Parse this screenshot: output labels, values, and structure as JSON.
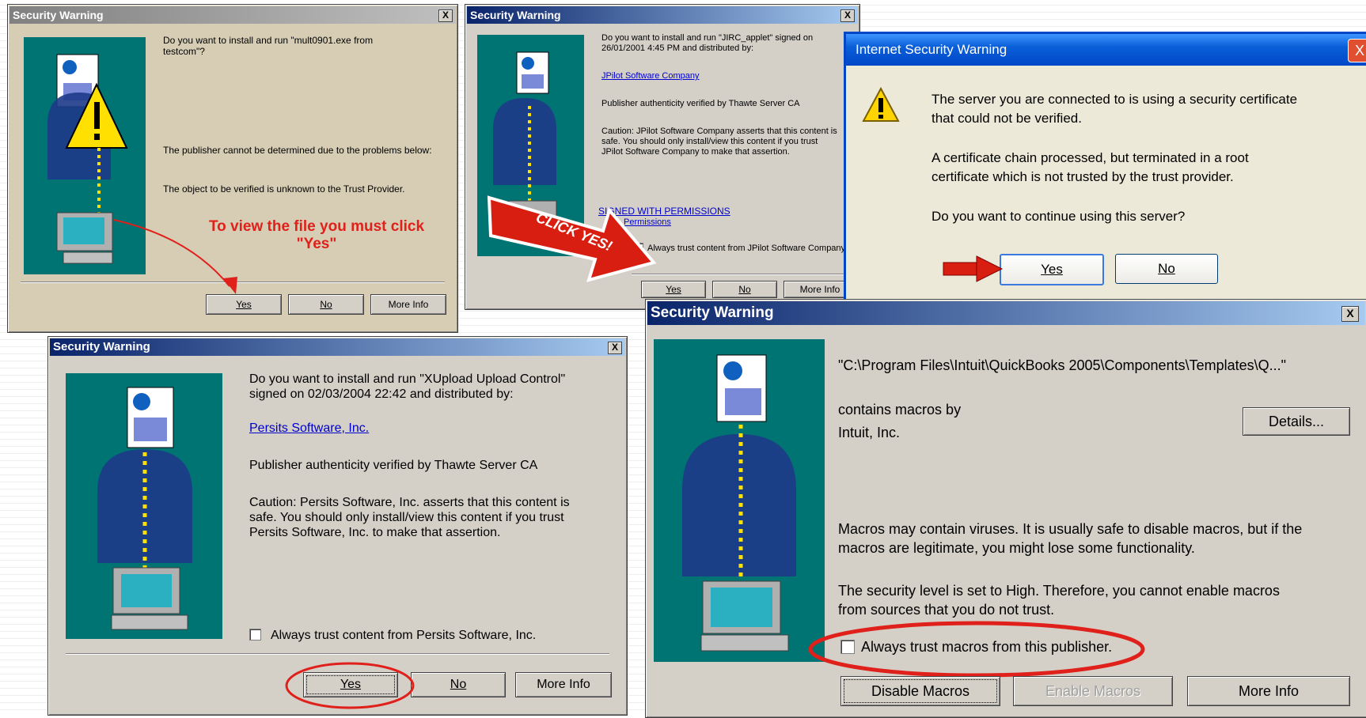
{
  "d1": {
    "title": "Security Warning",
    "question": "Do you want to install and run \"mult0901.exe from testcom\"?",
    "publisher_msg": "The publisher cannot be determined due to the problems below:",
    "object_msg": "The object to be verified is unknown to the Trust Provider.",
    "annotation_line1": "To view the file you must click",
    "annotation_line2": "\"Yes\"",
    "yes": "Yes",
    "no": "No",
    "more": "More Info",
    "close": "X"
  },
  "d2": {
    "title": "Security Warning",
    "question": "Do you want to install and run \"JIRC_applet\" signed on 26/01/2001 4:45 PM and distributed by:",
    "company": "JPilot Software Company",
    "verified": "Publisher authenticity verified by Thawte Server CA",
    "caution": "Caution: JPilot Software Company asserts that this content is safe. You should only install/view this content if you trust JPilot Software Company to make that assertion.",
    "signed_link": "SIGNED WITH PERMISSIONS",
    "permissions_link": "Permissions",
    "trust": "Always trust content from JPilot Software Company",
    "click_yes": "CLICK YES!",
    "yes": "Yes",
    "no": "No",
    "more": "More Info",
    "close": "X"
  },
  "d3": {
    "title": "Internet Security Warning",
    "line1": "The server you are connected to is using a security certificate",
    "line2": "that could not be verified.",
    "line3": "A certificate chain processed, but terminated in a root",
    "line4": "certificate which is not trusted by the trust provider.",
    "line5": "Do you want to continue using this server?",
    "yes": "Yes",
    "no": "No",
    "close": "X"
  },
  "d4": {
    "title": "Security Warning",
    "question1": "Do you want to install and run \"XUpload Upload Control\"",
    "question2": "signed on 02/03/2004 22:42 and distributed by:",
    "company": "Persits Software, Inc.",
    "verified": "Publisher authenticity verified by Thawte Server CA",
    "caution1": "Caution: Persits Software, Inc. asserts that this content is",
    "caution2": "safe.  You should only install/view this content if you trust",
    "caution3": "Persits Software, Inc. to make that assertion.",
    "trust": "Always trust content from Persits Software, Inc.",
    "yes": "Yes",
    "no": "No",
    "more": "More Info",
    "close": "X"
  },
  "d5": {
    "title": "Security Warning",
    "path": "\"C:\\Program Files\\Intuit\\QuickBooks 2005\\Components\\Templates\\Q...\"",
    "macros_by": "contains macros by",
    "publisher": "Intuit, Inc.",
    "details": "Details...",
    "virus1": "Macros may contain viruses. It is usually safe to disable macros, but if the",
    "virus2": "macros are legitimate, you might lose some functionality.",
    "level1": "The security level is set to High.  Therefore, you cannot enable macros",
    "level2": "from sources that you do not trust.",
    "trust": "Always trust macros from this publisher.",
    "disable": "Disable Macros",
    "enable": "Enable Macros",
    "more": "More Info",
    "close": "X"
  },
  "colors": {
    "annotation_red": "#e0201a",
    "panel_teal": "#007373",
    "dialog_grey": "#d4d0c8"
  }
}
